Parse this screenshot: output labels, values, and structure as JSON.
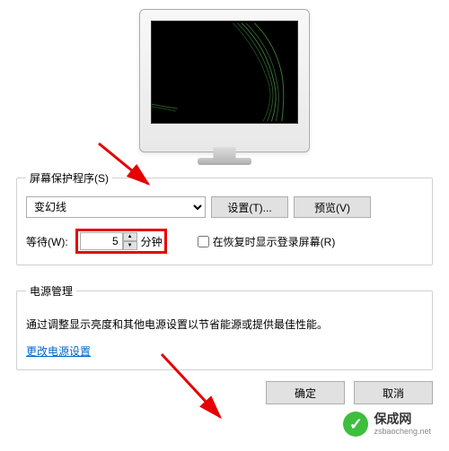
{
  "screensaver": {
    "legend": "屏幕保护程序(S)",
    "selected": "变幻线",
    "settings_btn": "设置(T)...",
    "preview_btn": "预览(V)",
    "wait_label": "等待(W):",
    "wait_value": "5",
    "minutes_label": "分钟",
    "resume_label": "在恢复时显示登录屏幕(R)"
  },
  "power": {
    "legend": "电源管理",
    "desc": "通过调整显示亮度和其他电源设置以节省能源或提供最佳性能。",
    "link": "更改电源设置"
  },
  "dialog": {
    "ok": "确定",
    "cancel": "取消"
  },
  "watermark": {
    "cn": "保成网",
    "url": "zsbaocheng.net"
  }
}
